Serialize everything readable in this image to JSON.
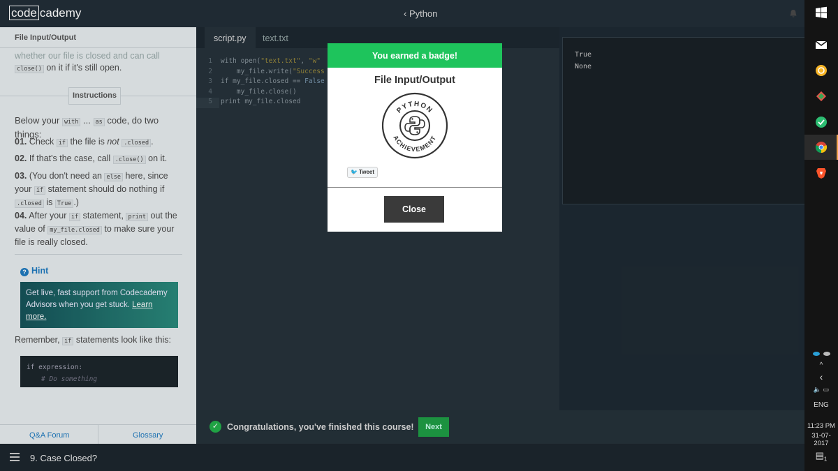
{
  "topbar": {
    "logo_left": "code",
    "logo_right": "cademy",
    "course": "Python"
  },
  "lesson": {
    "header": "File Input/Output",
    "intro_top": "whether our file is closed and can call",
    "intro_code": "close()",
    "intro_rest": "on it if it's still open.",
    "instructions_label": "Instructions",
    "below_prefix": "Below your",
    "below_code1": "with",
    "below_mid": "...",
    "below_code2": "as",
    "below_suffix": "code, do two things:",
    "step1_num": "01.",
    "step1_a": "Check",
    "step1_code1": "if",
    "step1_b": "the file is",
    "step1_em": "not",
    "step1_code2": ".closed",
    "step1_c": ".",
    "step2_num": "02.",
    "step2_a": "If that's the case, call",
    "step2_code": ".close()",
    "step2_b": "on it.",
    "step3_num": "03.",
    "step3_a": "(You don't need an",
    "step3_code1": "else",
    "step3_b": "here, since your",
    "step3_code2": "if",
    "step3_c": "statement should do nothing if",
    "step3_code3": ".closed",
    "step3_d": "is",
    "step3_code4": "True",
    "step3_e": ".)",
    "step4_num": "04.",
    "step4_a": "After your",
    "step4_code1": "if",
    "step4_b": "statement,",
    "step4_code2": "print",
    "step4_c": "out the value of",
    "step4_code3": "my_file.closed",
    "step4_d": "to make sure your file is really closed.",
    "hint_label": "Hint",
    "advisors_text": "Get live, fast support from Codecademy Advisors when you get stuck.",
    "advisors_link": "Learn more.",
    "remember_a": "Remember,",
    "remember_code": "if",
    "remember_b": "statements look like this:",
    "code_line1": "if expression:",
    "code_line2": "# Do something",
    "footer_left": "Q&A Forum",
    "footer_right": "Glossary"
  },
  "editor": {
    "tabs": [
      "script.py",
      "text.txt"
    ],
    "line_numbers": [
      "1",
      "2",
      "3",
      "4",
      "5"
    ],
    "lines": {
      "l1_kw": "with open(",
      "l1_s1": "\"text.txt\"",
      "l1_sep": ", ",
      "l1_s2": "\"w\"",
      "l2_a": "    my_file.write(",
      "l2_s": "\"Success",
      "l3_a": "if my_file.closed == ",
      "l3_k": "False",
      "l4": "    my_file.close()",
      "l5": "print my_file.closed"
    }
  },
  "console": {
    "lines": [
      "True",
      "None"
    ]
  },
  "bottom_bar": {
    "congrats": "Congratulations, you've finished this course!",
    "next": "Next"
  },
  "bottom_nav": {
    "exercise": "9. Case Closed?"
  },
  "modal": {
    "header": "You earned a badge!",
    "title": "File Input/Output",
    "badge_text_top": "PYTHON",
    "badge_text_bottom": "ACHIEVEMENT",
    "tweet": "Tweet",
    "close": "Close"
  },
  "taskbar": {
    "language": "ENG",
    "time": "11:23 PM",
    "date": "31-07-2017",
    "notifications": "1"
  }
}
